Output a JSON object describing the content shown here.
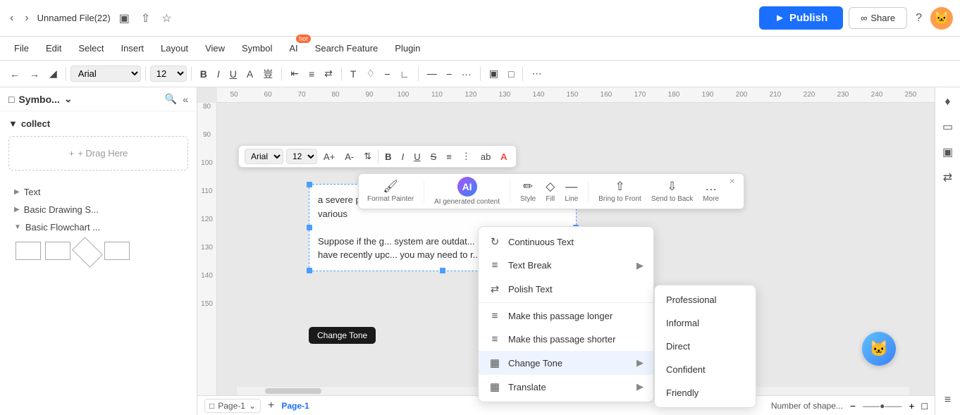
{
  "app": {
    "title": "Unnamed File(22)"
  },
  "topbar": {
    "publish_label": "Publish",
    "share_label": "Share",
    "help_icon": "?",
    "avatar_icon": "🐱"
  },
  "menubar": {
    "items": [
      {
        "label": "File"
      },
      {
        "label": "Edit"
      },
      {
        "label": "Select"
      },
      {
        "label": "Insert"
      },
      {
        "label": "Layout"
      },
      {
        "label": "View"
      },
      {
        "label": "Symbol"
      },
      {
        "label": "AI"
      },
      {
        "label": "Search Feature"
      },
      {
        "label": "Plugin"
      }
    ],
    "ai_badge": "hot"
  },
  "toolbar": {
    "font": "Arial",
    "size": "12",
    "bold": "B",
    "italic": "I",
    "underline": "U"
  },
  "sidebar": {
    "title": "Symbo...",
    "section_collect": "collect",
    "drag_label": "+ Drag Here",
    "tree_items": [
      {
        "label": "Text",
        "arrow": "▶"
      },
      {
        "label": "Basic Drawing S...",
        "arrow": "▶"
      },
      {
        "label": "Basic Flowchart ...",
        "arrow": "▼"
      }
    ]
  },
  "float_toolbar": {
    "font": "Arial",
    "size": "12",
    "bold": "B",
    "italic": "I",
    "underline": "U",
    "strikethrough": "S",
    "highlight": "ab",
    "color": "A"
  },
  "ai_toolbar": {
    "items": [
      {
        "icon": "🖌",
        "label": "Format Painter"
      },
      {
        "icon": "AI",
        "label": "AI generated content",
        "is_ai": true
      },
      {
        "icon": "✏",
        "label": "Style"
      },
      {
        "icon": "◇",
        "label": "Fill"
      },
      {
        "icon": "—",
        "label": "Line"
      },
      {
        "icon": "⇄",
        "label": "Bring to Front"
      },
      {
        "icon": "⇄",
        "label": "Send to Back"
      },
      {
        "icon": "⋯",
        "label": "More"
      }
    ]
  },
  "text_content": {
    "para1": "a severe problem in launching successfully. There might be various",
    "para2": "Suppose if the g... system are outdat... missing, then the U... have recently upc... you may need to r..."
  },
  "ctx_menu": {
    "items": [
      {
        "icon": "⟳",
        "label": "Continuous Text",
        "has_arrow": false
      },
      {
        "icon": "≡",
        "label": "Text Break",
        "has_arrow": true
      },
      {
        "icon": "⇄",
        "label": "Polish Text",
        "has_arrow": false
      },
      {
        "icon": "≡",
        "label": "Make this passage longer",
        "has_arrow": false
      },
      {
        "icon": "≡",
        "label": "Make this passage shorter",
        "has_arrow": false
      },
      {
        "icon": "⊞",
        "label": "Change Tone",
        "has_arrow": true,
        "active": true
      },
      {
        "icon": "⊟",
        "label": "Translate",
        "has_arrow": true
      }
    ]
  },
  "sub_menu": {
    "items": [
      {
        "label": "Professional"
      },
      {
        "label": "Informal"
      },
      {
        "label": "Direct"
      },
      {
        "label": "Confident"
      },
      {
        "label": "Friendly"
      }
    ]
  },
  "change_tone_tooltip": "Change Tone",
  "bottom": {
    "page_label": "Page-1",
    "page_display": "Page-1",
    "add_icon": "+",
    "status": "Number of shape..."
  },
  "ruler": {
    "h_marks": [
      "50",
      "60",
      "70",
      "80",
      "90",
      "100",
      "110",
      "120",
      "130",
      "140",
      "150",
      "160",
      "170",
      "180",
      "190",
      "200",
      "210",
      "220",
      "230",
      "240",
      "250"
    ],
    "v_marks": [
      "80",
      "90",
      "100",
      "110",
      "120",
      "130",
      "140",
      "150"
    ]
  }
}
